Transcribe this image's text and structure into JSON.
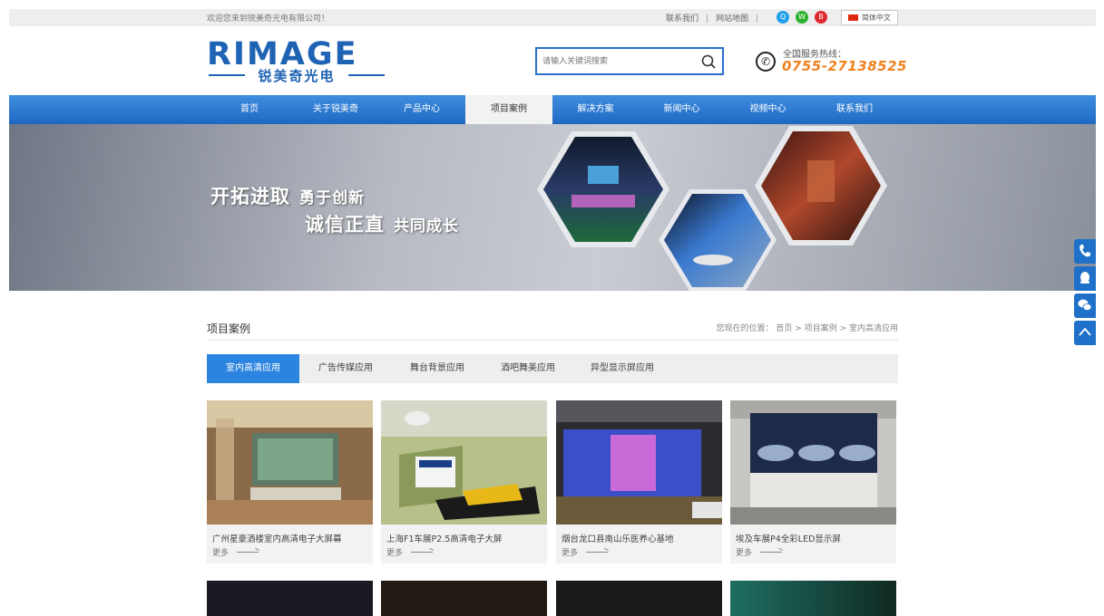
{
  "topbar": {
    "welcome": "欢迎您来到锐美奇光电有限公司！",
    "links": [
      "联系我们",
      "网站地图"
    ],
    "language": "简体中文"
  },
  "header": {
    "logo_text": "RIMAGE",
    "logo_sub": "锐美奇光电",
    "search_placeholder": "请输入关键词搜索",
    "hotline_label": "全国服务热线：",
    "hotline_number": "0755-27138525"
  },
  "nav": {
    "items": [
      "首页",
      "关于锐美奇",
      "产品中心",
      "项目案例",
      "解决方案",
      "新闻中心",
      "视频中心",
      "联系我们"
    ],
    "active_index": 3
  },
  "banner": {
    "line1_a": "开拓进取",
    "line1_b": "勇于创新",
    "line2_a": "诚信正直",
    "line2_b": "共同成长"
  },
  "section": {
    "title": "项目案例",
    "breadcrumb_prefix": "您现在的位置：",
    "breadcrumb": [
      "首页",
      "项目案例",
      "室内高清应用"
    ]
  },
  "tabs": {
    "items": [
      "室内高清应用",
      "广告传媒应用",
      "舞台背景应用",
      "酒吧舞美应用",
      "异型显示屏应用"
    ],
    "active_index": 0
  },
  "cases": [
    {
      "title": "广州星豪酒楼室内高清电子大屏幕",
      "more": "更多"
    },
    {
      "title": "上海F1车展P2.5高清电子大屏",
      "more": "更多"
    },
    {
      "title": "烟台龙口县南山乐医养心基地",
      "more": "更多"
    },
    {
      "title": "埃及车展P4全彩LED显示屏",
      "more": "更多"
    }
  ],
  "colors": {
    "brand_blue": "#1f63b4",
    "nav_blue": "#2b78d0",
    "hotline_orange": "#f0821e",
    "tab_active": "#2b84df"
  },
  "icons": {
    "search": "magnifier-icon",
    "phone": "phone-icon",
    "qq": "qq-icon",
    "wechat": "wechat-icon",
    "weibo": "weibo-icon",
    "top": "chevron-up-icon"
  }
}
